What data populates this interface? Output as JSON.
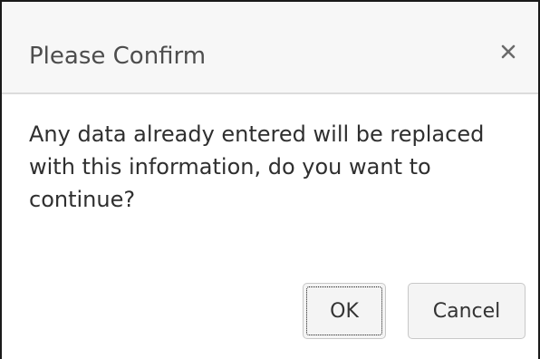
{
  "dialog": {
    "title": "Please Confirm",
    "close_icon": "close-icon",
    "message": "Any data already entered will be replaced with this information, do you want to continue?",
    "buttons": {
      "ok_label": "OK",
      "cancel_label": "Cancel"
    }
  }
}
